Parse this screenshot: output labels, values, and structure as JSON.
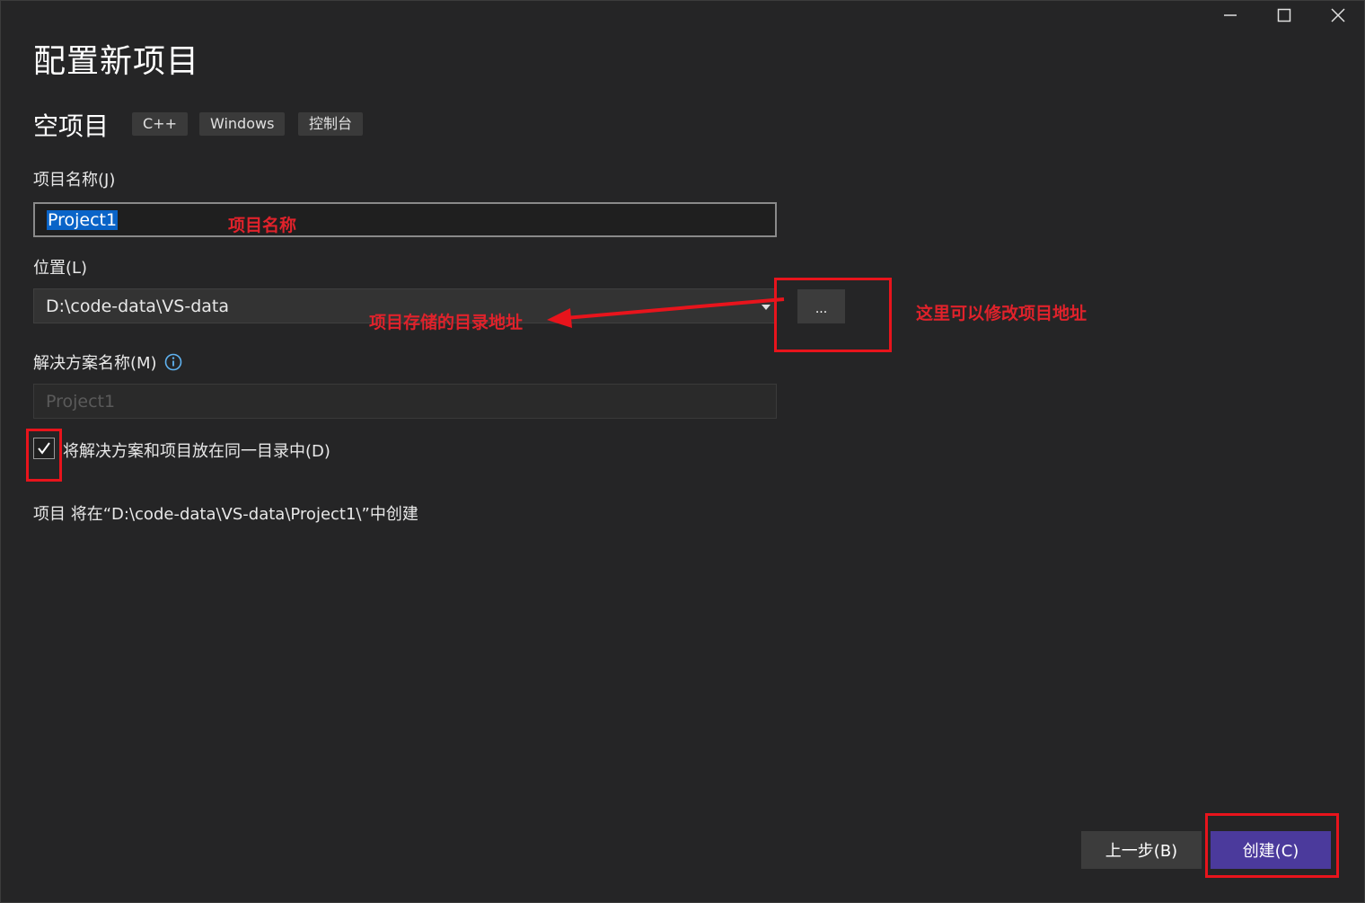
{
  "window": {
    "title": "配置新项目",
    "controls": {
      "minimize": "—",
      "maximize": "☐",
      "close": "✕"
    }
  },
  "template": {
    "name": "空项目",
    "tags": [
      "C++",
      "Windows",
      "控制台"
    ]
  },
  "project_name": {
    "label": "项目名称(J)",
    "value": "Project1"
  },
  "location": {
    "label": "位置(L)",
    "value": "D:\\code-data\\VS-data",
    "browse_label": "..."
  },
  "solution_name": {
    "label": "解决方案名称(M)",
    "placeholder": "Project1",
    "info_icon": "info-icon"
  },
  "same_dir_checkbox": {
    "label": "将解决方案和项目放在同一目录中(D)",
    "checked": true
  },
  "summary": "项目 将在“D:\\code-data\\VS-data\\Project1\\”中创建",
  "buttons": {
    "back": "上一步(B)",
    "create": "创建(C)"
  },
  "annotations": {
    "name_note": "项目名称",
    "location_note": "项目存储的目录地址",
    "browse_note": "这里可以修改项目地址"
  },
  "colors": {
    "background": "#252526",
    "input_bg": "#1f1f1f",
    "accent": "#4b3a9c",
    "annotation": "#e8141c",
    "selection": "#0a64c8"
  }
}
